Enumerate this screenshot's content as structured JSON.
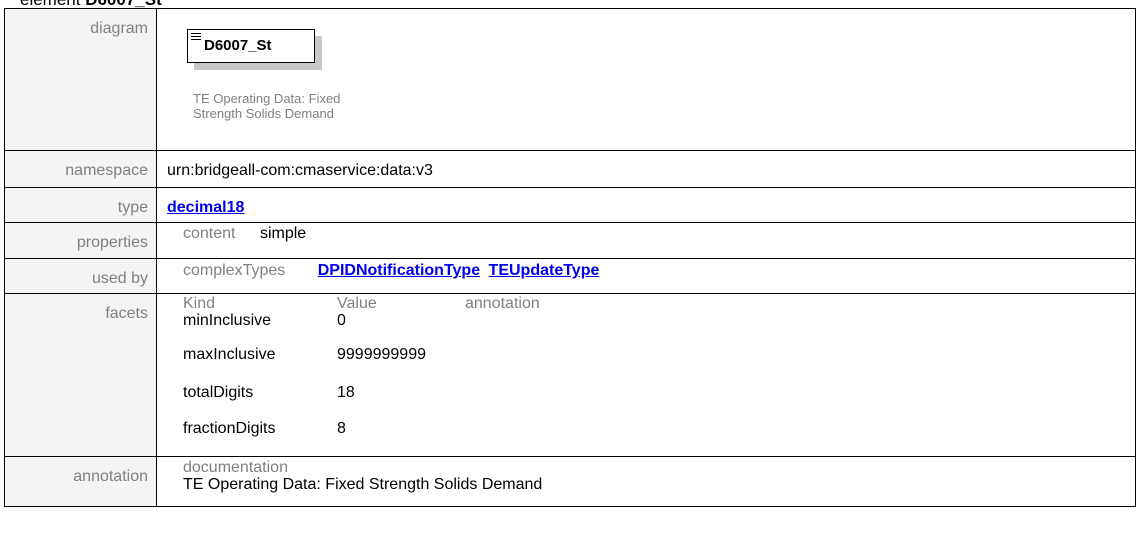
{
  "heading": {
    "prefix": "element ",
    "name": "D6007_St"
  },
  "diagram": {
    "label": "diagram",
    "element_name": "D6007_St",
    "caption": "TE Operating Data: Fixed Strength Solids Demand"
  },
  "rows": {
    "namespace": {
      "label": "namespace",
      "value": "urn:bridgeall-com:cmaservice:data:v3"
    },
    "type": {
      "label": "type",
      "value": "decimal18"
    },
    "properties": {
      "label": "properties",
      "key": "content",
      "value": "simple"
    },
    "used_by": {
      "label": "used by",
      "key": "complexTypes",
      "links": [
        "DPIDNotificationType",
        "TEUpdateType"
      ]
    },
    "facets": {
      "label": "facets",
      "headers": [
        "Kind",
        "Value",
        "annotation"
      ],
      "items": [
        {
          "kind": "minInclusive",
          "value": "0"
        },
        {
          "kind": "maxInclusive",
          "value": "9999999999"
        },
        {
          "kind": "totalDigits",
          "value": "18"
        },
        {
          "kind": "fractionDigits",
          "value": "8"
        }
      ]
    },
    "annotation": {
      "label": "annotation",
      "key": "documentation",
      "value": "TE Operating Data: Fixed Strength Solids Demand"
    }
  }
}
